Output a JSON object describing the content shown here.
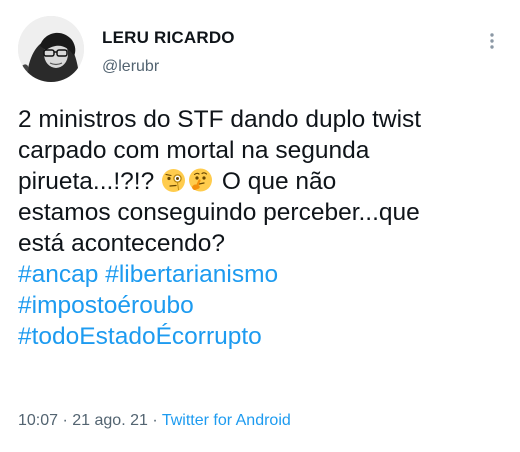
{
  "user": {
    "display_name": "LERU RICARDO",
    "handle": "@lerubr"
  },
  "tweet": {
    "line1": "2 ministros do STF dando duplo twist",
    "line2": "carpado com mortal na segunda",
    "line3_start": "pirueta...!?!?",
    "line3_end": "O que não",
    "line4": "estamos conseguindo perceber...que",
    "line5": "está acontecendo?",
    "emojis": [
      "face-with-monocle",
      "thinking-face"
    ],
    "hashtags": [
      "#ancap",
      "#libertarianismo",
      "#impostoéroubo",
      "#todoEstadoÉcorrupto"
    ]
  },
  "meta": {
    "time": "10:07",
    "sep1": " · ",
    "date": "21 ago. 21",
    "sep2": " · ",
    "source": "Twitter for Android"
  },
  "colors": {
    "link": "#1d9bf0",
    "secondary_text": "#536471",
    "primary_text": "#0f1419"
  }
}
